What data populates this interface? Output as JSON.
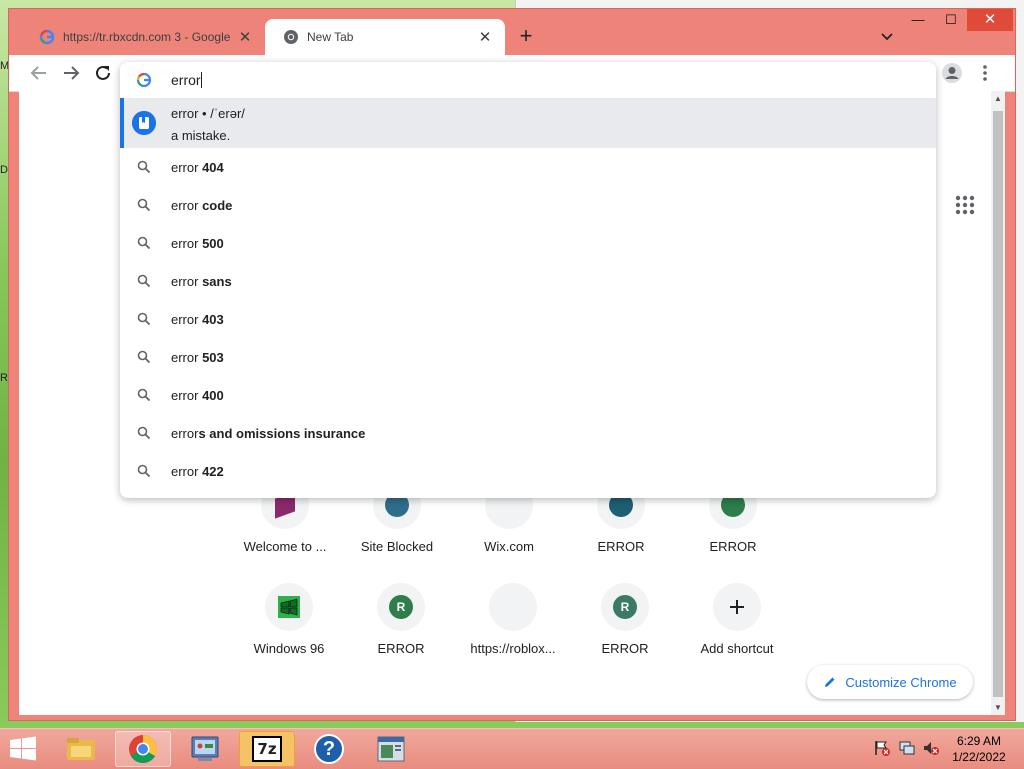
{
  "desktop": {
    "labels": [
      "M",
      "D",
      "R"
    ]
  },
  "tabs": [
    {
      "title": "https://tr.rbxcdn.com 3 - Google",
      "icon": "google-icon",
      "active": false
    },
    {
      "title": "New Tab",
      "icon": "chrome-icon",
      "active": true
    }
  ],
  "window": {
    "minimize": "—",
    "maximize": "☐",
    "close": "✕"
  },
  "omnibox": {
    "value": "error",
    "dictionary": {
      "line1": "error • /ˈerər/",
      "line2": "a mistake."
    },
    "suggestions": [
      {
        "prefix": "error",
        "bold": " 404"
      },
      {
        "prefix": "error",
        "bold": " code"
      },
      {
        "prefix": "error",
        "bold": " 500"
      },
      {
        "prefix": "error",
        "bold": " sans"
      },
      {
        "prefix": "error",
        "bold": " 403"
      },
      {
        "prefix": "error",
        "bold": " 503"
      },
      {
        "prefix": "error",
        "bold": " 400"
      },
      {
        "prefix": "error",
        "bold": "s and omissions insurance"
      },
      {
        "prefix": "error",
        "bold": " 422"
      }
    ]
  },
  "shortcuts": {
    "row1": [
      "Welcome to ...",
      "Site Blocked",
      "Wix.com",
      "ERROR",
      "ERROR"
    ],
    "row2": [
      {
        "label": "Windows 96",
        "icon": "windows96-icon"
      },
      {
        "label": "ERROR",
        "badge": "R",
        "color": "#2e7d4a"
      },
      {
        "label": "https://roblox...",
        "icon": "blank-icon"
      },
      {
        "label": "ERROR",
        "badge": "R",
        "color": "#3d7a65"
      },
      {
        "label": "Add shortcut",
        "icon": "plus-icon"
      }
    ]
  },
  "customize": {
    "label": "Customize Chrome"
  },
  "colors": {
    "chrome_frame": "#ee8479",
    "accent": "#1a73e8",
    "taskbar": "#e98c7f"
  },
  "taskbar": {
    "apps": [
      "file-explorer-icon",
      "chrome-icon",
      "control-panel-icon",
      "7zip-icon",
      "help-icon",
      "app-window-icon"
    ],
    "sevenzip_label": "7z",
    "help_label": "?",
    "clock": {
      "time": "6:29 AM",
      "date": "1/22/2022"
    }
  }
}
